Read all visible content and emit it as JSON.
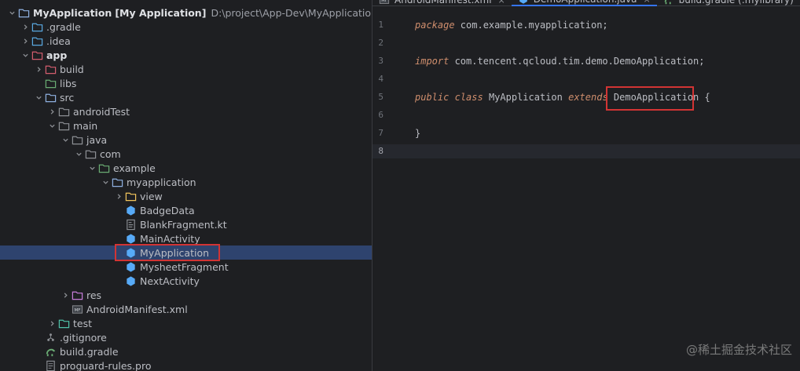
{
  "tree": {
    "rows": [
      {
        "label": "MyApplication",
        "label2": "[My Application]",
        "path": "D:\\project\\App-Dev\\MyApplication",
        "icon": "module-folder-icon",
        "color": "#8fb0e0"
      },
      {
        "label": ".gradle",
        "icon": "folder-icon",
        "color": "#59a8e0"
      },
      {
        "label": ".idea",
        "icon": "folder-icon",
        "color": "#59a8e0"
      },
      {
        "label": "app",
        "icon": "android-module-folder-icon",
        "color": "#d35d6e"
      },
      {
        "label": "build",
        "icon": "excluded-folder-icon",
        "color": "#d35d6e"
      },
      {
        "label": "libs",
        "icon": "library-folder-icon",
        "color": "#6aab73"
      },
      {
        "label": "src",
        "icon": "source-folder-icon",
        "color": "#8fb0e0"
      },
      {
        "label": "androidTest",
        "icon": "folder-icon",
        "color": "#8c8f94"
      },
      {
        "label": "main",
        "icon": "folder-icon",
        "color": "#8c8f94"
      },
      {
        "label": "java",
        "icon": "folder-icon",
        "color": "#8c8f94"
      },
      {
        "label": "com",
        "icon": "folder-icon",
        "color": "#8c8f94"
      },
      {
        "label": "example",
        "icon": "package-icon",
        "color": "#6aab73"
      },
      {
        "label": "myapplication",
        "icon": "folder-icon",
        "color": "#8fb0e0"
      },
      {
        "label": "view",
        "icon": "folder-icon",
        "color": "#f2c55c"
      },
      {
        "label": "BadgeData",
        "icon": "java-class-icon",
        "color": "#57aaf7"
      },
      {
        "label": "BlankFragment.kt",
        "icon": "kotlin-file-icon",
        "color": "#8c8f94"
      },
      {
        "label": "MainActivity",
        "icon": "java-class-icon",
        "color": "#57aaf7"
      },
      {
        "label": "MyApplication",
        "icon": "java-class-icon",
        "color": "#57aaf7"
      },
      {
        "label": "MysheetFragment",
        "icon": "java-class-icon",
        "color": "#57aaf7"
      },
      {
        "label": "NextActivity",
        "icon": "java-class-icon",
        "color": "#57aaf7"
      },
      {
        "label": "res",
        "icon": "resource-folder-icon",
        "color": "#c77dda"
      },
      {
        "label": "AndroidManifest.xml",
        "icon": "manifest-file-icon",
        "color": "#8c8f94"
      },
      {
        "label": "test",
        "icon": "test-folder-icon",
        "color": "#4fc1a8"
      },
      {
        "label": ".gitignore",
        "icon": "gitignore-file-icon",
        "color": "#8c8f94"
      },
      {
        "label": "build.gradle",
        "icon": "gradle-file-icon",
        "color": "#6aab73"
      },
      {
        "label": "proguard-rules.pro",
        "icon": "text-file-icon",
        "color": "#8c8f94"
      }
    ]
  },
  "tabs": [
    {
      "label": "AndroidManifest.xml",
      "icon": "manifest-file-icon",
      "close": "×"
    },
    {
      "label": "DemoApplication.java",
      "icon": "java-class-icon",
      "close": "×"
    },
    {
      "label": "build.gradle (:mylibrary)",
      "icon": "gradle-file-icon",
      "close": "×"
    }
  ],
  "editor": {
    "lines": [
      {
        "n": "1",
        "parts": [
          {
            "t": "package",
            "k": "kw"
          },
          {
            "t": " com.example.myapplication;",
            "k": "tx"
          }
        ]
      },
      {
        "n": "2",
        "parts": []
      },
      {
        "n": "3",
        "parts": [
          {
            "t": "import",
            "k": "kw"
          },
          {
            "t": " com.tencent.qcloud.tim.demo.DemoApplication;",
            "k": "tx"
          }
        ]
      },
      {
        "n": "4",
        "parts": []
      },
      {
        "n": "5",
        "parts": [
          {
            "t": "public",
            "k": "kw"
          },
          {
            "t": " ",
            "k": "tx"
          },
          {
            "t": "class",
            "k": "kw"
          },
          {
            "t": " MyApplication ",
            "k": "tx"
          },
          {
            "t": "extends",
            "k": "kw"
          },
          {
            "t": " ",
            "k": "tx"
          },
          {
            "t": "DemoApplication",
            "k": "tx"
          },
          {
            "t": " {",
            "k": "tx"
          }
        ]
      },
      {
        "n": "6",
        "parts": []
      },
      {
        "n": "7",
        "parts": [
          {
            "t": "}",
            "k": "tx"
          }
        ]
      },
      {
        "n": "8",
        "parts": []
      }
    ],
    "current_line": "8"
  },
  "watermark": "@稀土掘金技术社区"
}
